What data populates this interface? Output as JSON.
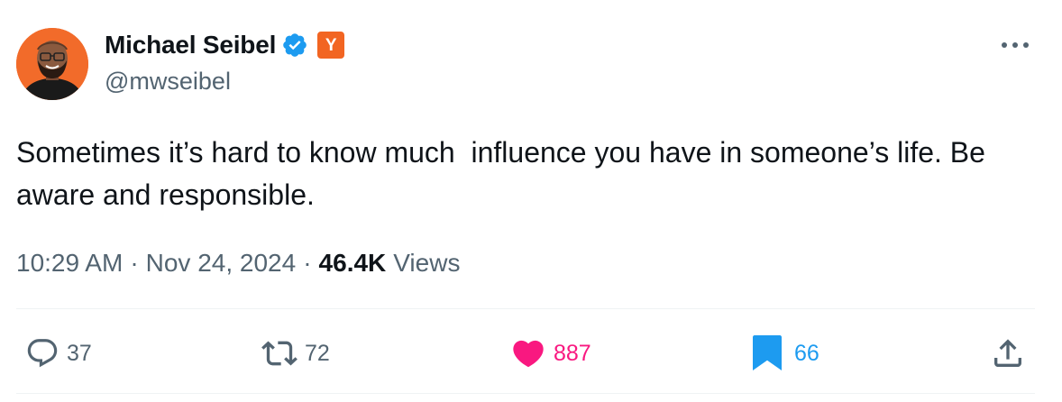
{
  "author": {
    "display_name": "Michael Seibel",
    "handle": "@mwseibel",
    "affiliate_badge_text": "Y",
    "verified_color": "#1d9bf0",
    "affiliate_color": "#f26522"
  },
  "tweet": {
    "text": "Sometimes it’s hard to know much  influence you have in someone’s life. Be aware and responsible.",
    "time": "10:29 AM",
    "separator": "·",
    "date": "Nov 24, 2024",
    "views_count": "46.4K",
    "views_label": "Views"
  },
  "actions": {
    "reply": {
      "icon": "reply-icon",
      "count": "37",
      "color": "#536471"
    },
    "retweet": {
      "icon": "retweet-icon",
      "count": "72",
      "color": "#536471"
    },
    "like": {
      "icon": "heart-icon",
      "count": "887",
      "color": "#f91880"
    },
    "bookmark": {
      "icon": "bookmark-icon",
      "count": "66",
      "color": "#1d9bf0"
    },
    "share": {
      "icon": "share-icon",
      "color": "#536471"
    }
  },
  "icons": {
    "more": "more-horizontal-icon"
  }
}
